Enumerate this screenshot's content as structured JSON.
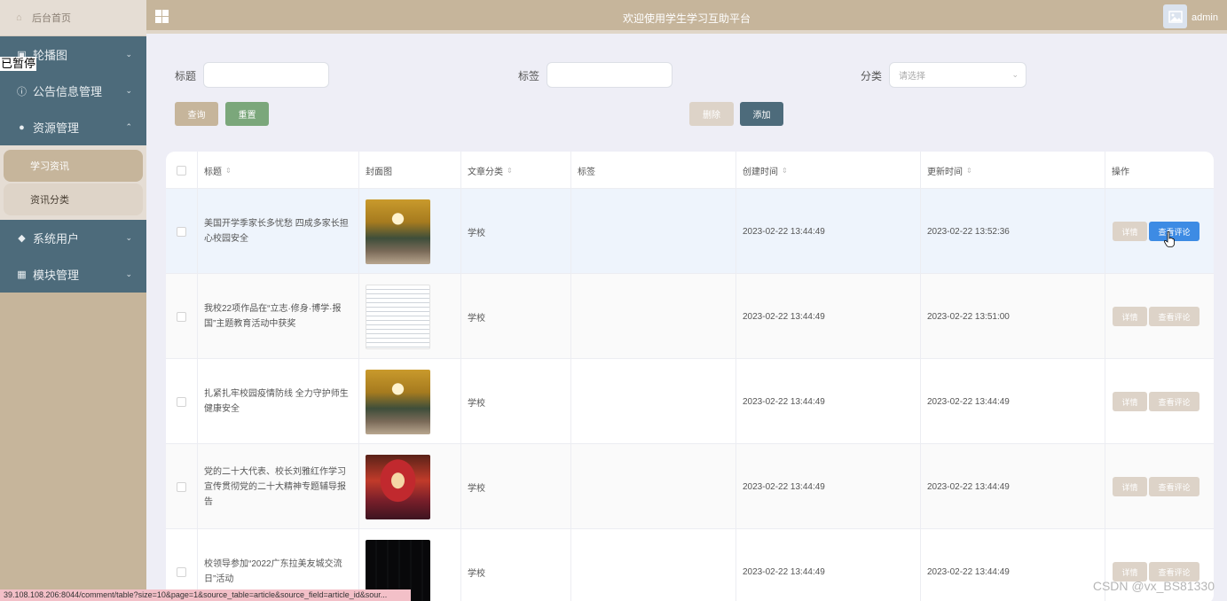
{
  "sidebar": {
    "home": "后台首页",
    "overlay_text": "已暂停",
    "menus": [
      {
        "label": "轮播图",
        "icon": "image-icon"
      },
      {
        "label": "公告信息管理",
        "icon": "info-icon"
      },
      {
        "label": "资源管理",
        "icon": "bulb-icon",
        "expanded": true
      },
      {
        "label": "系统用户",
        "icon": "user-icon"
      },
      {
        "label": "模块管理",
        "icon": "grid-icon"
      }
    ],
    "submenu": [
      {
        "label": "学习资讯",
        "active": true
      },
      {
        "label": "资讯分类",
        "active": false
      }
    ]
  },
  "header": {
    "title": "欢迎使用学生学习互助平台",
    "user": "admin"
  },
  "search": {
    "title_label": "标题",
    "tag_label": "标签",
    "category_label": "分类",
    "category_placeholder": "请选择",
    "query_btn": "查询",
    "reset_btn": "重置",
    "delete_btn": "删除",
    "add_btn": "添加"
  },
  "table": {
    "columns": [
      "标题",
      "封面图",
      "文章分类",
      "标签",
      "创建时间",
      "更新时间",
      "操作"
    ],
    "detail_btn": "详情",
    "comment_btn": "查看评论",
    "rows": [
      {
        "title": "美国开学季家长多忧愁 四成多家长担心校园安全",
        "cover": "trees",
        "category": "学校",
        "tag": "",
        "created": "2023-02-22 13:44:49",
        "updated": "2023-02-22 13:52:36"
      },
      {
        "title": "我校22项作品在“立志·修身·博学·报国”主题教育活动中获奖",
        "cover": "doc",
        "category": "学校",
        "tag": "",
        "created": "2023-02-22 13:44:49",
        "updated": "2023-02-22 13:51:00"
      },
      {
        "title": "扎紧扎牢校园疫情防线 全力守护师生健康安全",
        "cover": "trees",
        "category": "学校",
        "tag": "",
        "created": "2023-02-22 13:44:49",
        "updated": "2023-02-22 13:44:49"
      },
      {
        "title": "党的二十大代表、校长刘雅红作学习宣传贯彻党的二十大精神专题辅导报告",
        "cover": "hall",
        "category": "学校",
        "tag": "",
        "created": "2023-02-22 13:44:49",
        "updated": "2023-02-22 13:44:49"
      },
      {
        "title": "校领导参加“2022广东拉美友城交流日”活动",
        "cover": "screen",
        "category": "学校",
        "tag": "",
        "created": "2023-02-22 13:44:49",
        "updated": "2023-02-22 13:44:49"
      }
    ]
  },
  "status_url": "39.108.108.206:8044/comment/table?size=10&page=1&source_table=article&source_field=article_id&sour...",
  "watermark": "CSDN @vx_BS81330",
  "colors": {
    "sidebar_bg": "#c6b59b",
    "menu_bg": "#4d6b7b",
    "accent_blue": "#3d8be4",
    "reset_green": "#7ba77b",
    "add_slate": "#4d6b7b"
  }
}
